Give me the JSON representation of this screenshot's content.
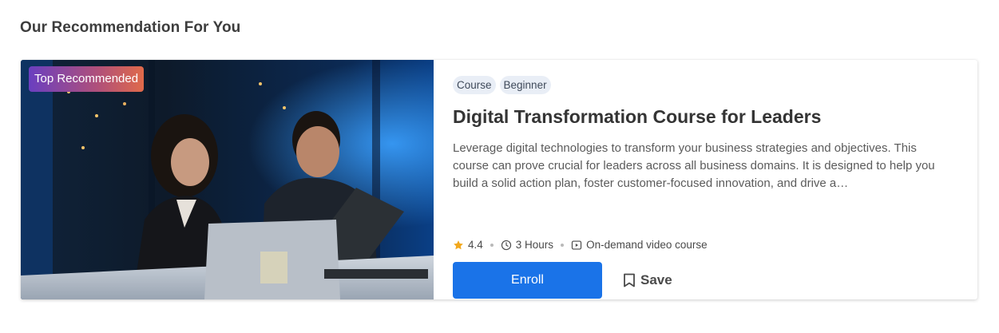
{
  "section": {
    "title": "Our Recommendation For You"
  },
  "card": {
    "badge": "Top Recommended",
    "tags": [
      "Course",
      "Beginner"
    ],
    "title": "Digital Transformation Course for Leaders",
    "description": "Leverage digital technologies to transform your business strategies and objectives. This course can prove crucial for leaders across all business domains. It is designed to help you build a solid action plan, foster customer-focused innovation, and drive a…",
    "rating": "4.4",
    "duration": "3 Hours",
    "format": "On-demand video course",
    "enroll_label": "Enroll",
    "save_label": "Save"
  },
  "icons": {
    "rating": "star-icon",
    "duration": "clock-icon",
    "format": "play-video-icon",
    "save": "bookmark-icon"
  },
  "colors": {
    "primary": "#1a73e8",
    "star": "#f2a81d",
    "chip_bg": "#e9eef6",
    "badge_gradient": [
      "#6a3fc0",
      "#e06a4a"
    ]
  }
}
